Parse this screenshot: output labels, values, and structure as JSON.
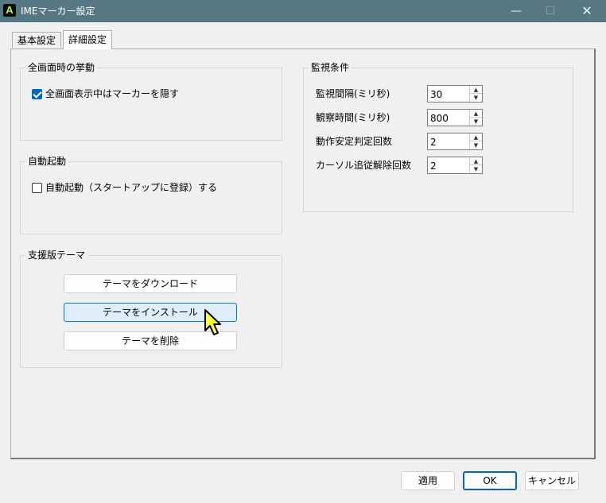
{
  "window": {
    "app_icon_letter": "A",
    "title": "IMEマーカー設定",
    "minimize_glyph": "—",
    "maximize_glyph": "☐",
    "close_glyph": "✕"
  },
  "tabs": [
    {
      "label": "基本設定",
      "selected": false
    },
    {
      "label": "詳細設定",
      "selected": true
    }
  ],
  "fullscreen_group": {
    "title": "全画面時の挙動",
    "checkbox_label": "全画面表示中はマーカーを隠す",
    "checked": true
  },
  "autostart_group": {
    "title": "自動起動",
    "checkbox_label": "自動起動（スタートアップに登録）する",
    "checked": false
  },
  "theme_group": {
    "title": "支援版テーマ",
    "download_label": "テーマをダウンロード",
    "install_label": "テーマをインストール",
    "delete_label": "テーマを削除"
  },
  "monitor_group": {
    "title": "監視条件",
    "fields": [
      {
        "label": "監視間隔(ミリ秒)",
        "value": "30"
      },
      {
        "label": "観察時間(ミリ秒)",
        "value": "800"
      },
      {
        "label": "動作安定判定回数",
        "value": "2"
      },
      {
        "label": "カーソル追従解除回数",
        "value": "2"
      }
    ],
    "spin_up_glyph": "▲",
    "spin_down_glyph": "▼"
  },
  "footer": {
    "apply_label": "適用",
    "ok_label": "OK",
    "cancel_label": "キャンセル"
  },
  "colors": {
    "titlebar": "#557883",
    "accent": "#0067c0",
    "hover_button": "#e0eef9",
    "cursor_fill": "#ffff33"
  }
}
